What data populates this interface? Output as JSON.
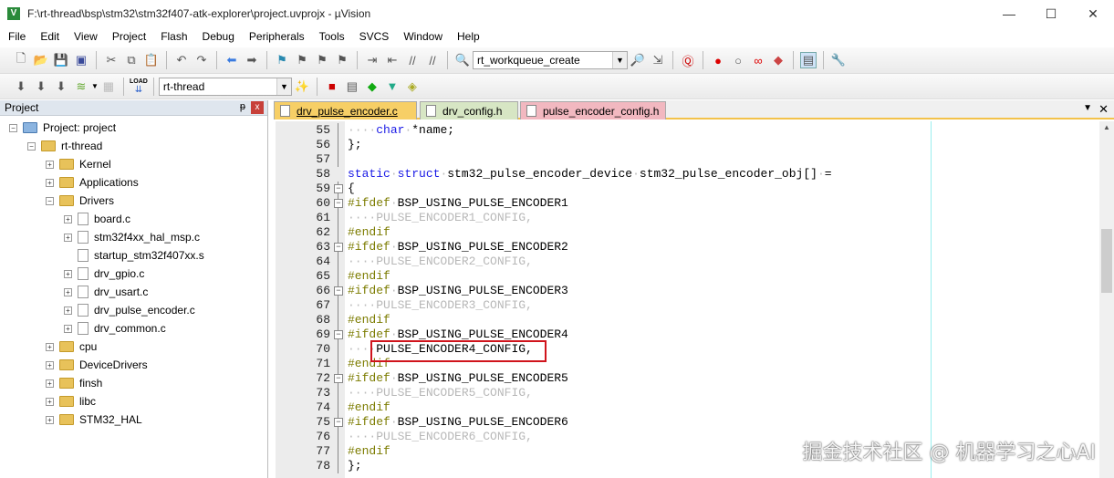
{
  "window": {
    "title": "F:\\rt-thread\\bsp\\stm32\\stm32f407-atk-explorer\\project.uvprojx - µVision",
    "minimize": "—",
    "maximize": "☐",
    "close": "✕"
  },
  "menu": [
    "File",
    "Edit",
    "View",
    "Project",
    "Flash",
    "Debug",
    "Peripherals",
    "Tools",
    "SVCS",
    "Window",
    "Help"
  ],
  "toolbar": {
    "find_combo": "rt_workqueue_create",
    "target_combo": "rt-thread",
    "load_label": "LOAD"
  },
  "project_panel": {
    "title": "Project",
    "pin": "ᵽ",
    "close": "x",
    "tree": [
      {
        "label": "Project: project",
        "level": 0,
        "type": "root",
        "exp": "−"
      },
      {
        "label": "rt-thread",
        "level": 1,
        "type": "target",
        "exp": "−"
      },
      {
        "label": "Kernel",
        "level": 2,
        "type": "folder",
        "exp": "+"
      },
      {
        "label": "Applications",
        "level": 2,
        "type": "folder",
        "exp": "+"
      },
      {
        "label": "Drivers",
        "level": 2,
        "type": "folder",
        "exp": "−"
      },
      {
        "label": "board.c",
        "level": 3,
        "type": "file",
        "exp": "+"
      },
      {
        "label": "stm32f4xx_hal_msp.c",
        "level": 3,
        "type": "file",
        "exp": "+"
      },
      {
        "label": "startup_stm32f407xx.s",
        "level": 3,
        "type": "file",
        "exp": ""
      },
      {
        "label": "drv_gpio.c",
        "level": 3,
        "type": "file",
        "exp": "+"
      },
      {
        "label": "drv_usart.c",
        "level": 3,
        "type": "file",
        "exp": "+"
      },
      {
        "label": "drv_pulse_encoder.c",
        "level": 3,
        "type": "file",
        "exp": "+"
      },
      {
        "label": "drv_common.c",
        "level": 3,
        "type": "file",
        "exp": "+"
      },
      {
        "label": "cpu",
        "level": 2,
        "type": "folder",
        "exp": "+"
      },
      {
        "label": "DeviceDrivers",
        "level": 2,
        "type": "folder",
        "exp": "+"
      },
      {
        "label": "finsh",
        "level": 2,
        "type": "folder",
        "exp": "+"
      },
      {
        "label": "libc",
        "level": 2,
        "type": "folder",
        "exp": "+"
      },
      {
        "label": "STM32_HAL",
        "level": 2,
        "type": "folder",
        "exp": "+"
      }
    ]
  },
  "tabs": [
    {
      "label": "drv_pulse_encoder.c",
      "color": "#f7cf66",
      "active": true
    },
    {
      "label": "drv_config.h",
      "color": "#d7e6c4",
      "active": false
    },
    {
      "label": "pulse_encoder_config.h",
      "color": "#f2b8c0",
      "active": false
    }
  ],
  "code": [
    {
      "n": "55",
      "fold": "line",
      "parts": [
        [
          "dot",
          "····"
        ],
        [
          "kw",
          "char"
        ],
        [
          "dot",
          "·"
        ],
        [
          "",
          "*name;"
        ]
      ]
    },
    {
      "n": "56",
      "fold": "line",
      "parts": [
        [
          "",
          "};"
        ]
      ]
    },
    {
      "n": "57",
      "fold": "tick",
      "parts": []
    },
    {
      "n": "58",
      "fold": "",
      "parts": [
        [
          "kw",
          "static"
        ],
        [
          "dot",
          "·"
        ],
        [
          "kw",
          "struct"
        ],
        [
          "dot",
          "·"
        ],
        [
          "",
          "stm32_pulse_encoder_device"
        ],
        [
          "dot",
          "·"
        ],
        [
          "",
          "stm32_pulse_encoder_obj[]"
        ],
        [
          "dot",
          "·"
        ],
        [
          "",
          "="
        ]
      ]
    },
    {
      "n": "59",
      "fold": "box",
      "parts": [
        [
          "",
          "{"
        ]
      ]
    },
    {
      "n": "60",
      "fold": "box",
      "parts": [
        [
          "pp",
          "#ifdef"
        ],
        [
          "dot",
          "·"
        ],
        [
          "",
          "BSP_USING_PULSE_ENCODER1"
        ]
      ]
    },
    {
      "n": "61",
      "fold": "line",
      "parts": [
        [
          "dot",
          "····"
        ],
        [
          "dim",
          "PULSE_ENCODER1_CONFIG,"
        ]
      ]
    },
    {
      "n": "62",
      "fold": "tick",
      "parts": [
        [
          "pp",
          "#endif"
        ]
      ]
    },
    {
      "n": "63",
      "fold": "box",
      "parts": [
        [
          "pp",
          "#ifdef"
        ],
        [
          "dot",
          "·"
        ],
        [
          "",
          "BSP_USING_PULSE_ENCODER2"
        ]
      ]
    },
    {
      "n": "64",
      "fold": "line",
      "parts": [
        [
          "dot",
          "····"
        ],
        [
          "dim",
          "PULSE_ENCODER2_CONFIG,"
        ]
      ]
    },
    {
      "n": "65",
      "fold": "tick",
      "parts": [
        [
          "pp",
          "#endif"
        ]
      ]
    },
    {
      "n": "66",
      "fold": "box",
      "parts": [
        [
          "pp",
          "#ifdef"
        ],
        [
          "dot",
          "·"
        ],
        [
          "",
          "BSP_USING_PULSE_ENCODER3"
        ]
      ]
    },
    {
      "n": "67",
      "fold": "line",
      "parts": [
        [
          "dot",
          "····"
        ],
        [
          "dim",
          "PULSE_ENCODER3_CONFIG,"
        ]
      ]
    },
    {
      "n": "68",
      "fold": "tick",
      "parts": [
        [
          "pp",
          "#endif"
        ]
      ]
    },
    {
      "n": "69",
      "fold": "box",
      "parts": [
        [
          "pp",
          "#ifdef"
        ],
        [
          "dot",
          "·"
        ],
        [
          "",
          "BSP_USING_PULSE_ENCODER4"
        ]
      ]
    },
    {
      "n": "70",
      "fold": "line",
      "parts": [
        [
          "dot",
          "····"
        ],
        [
          "",
          "PULSE_ENCODER4_CONFIG,"
        ]
      ]
    },
    {
      "n": "71",
      "fold": "tick",
      "parts": [
        [
          "pp",
          "#endif"
        ]
      ]
    },
    {
      "n": "72",
      "fold": "box",
      "parts": [
        [
          "pp",
          "#ifdef"
        ],
        [
          "dot",
          "·"
        ],
        [
          "",
          "BSP_USING_PULSE_ENCODER5"
        ]
      ]
    },
    {
      "n": "73",
      "fold": "line",
      "parts": [
        [
          "dot",
          "····"
        ],
        [
          "dim",
          "PULSE_ENCODER5_CONFIG,"
        ]
      ]
    },
    {
      "n": "74",
      "fold": "tick",
      "parts": [
        [
          "pp",
          "#endif"
        ]
      ]
    },
    {
      "n": "75",
      "fold": "box",
      "parts": [
        [
          "pp",
          "#ifdef"
        ],
        [
          "dot",
          "·"
        ],
        [
          "",
          "BSP_USING_PULSE_ENCODER6"
        ]
      ]
    },
    {
      "n": "76",
      "fold": "line",
      "parts": [
        [
          "dot",
          "····"
        ],
        [
          "dim",
          "PULSE_ENCODER6_CONFIG,"
        ]
      ]
    },
    {
      "n": "77",
      "fold": "tick",
      "parts": [
        [
          "pp",
          "#endif"
        ]
      ]
    },
    {
      "n": "78",
      "fold": "line",
      "parts": [
        [
          "",
          "};"
        ]
      ]
    }
  ],
  "watermark": "掘金技术社区 @ 机器学习之心AI"
}
